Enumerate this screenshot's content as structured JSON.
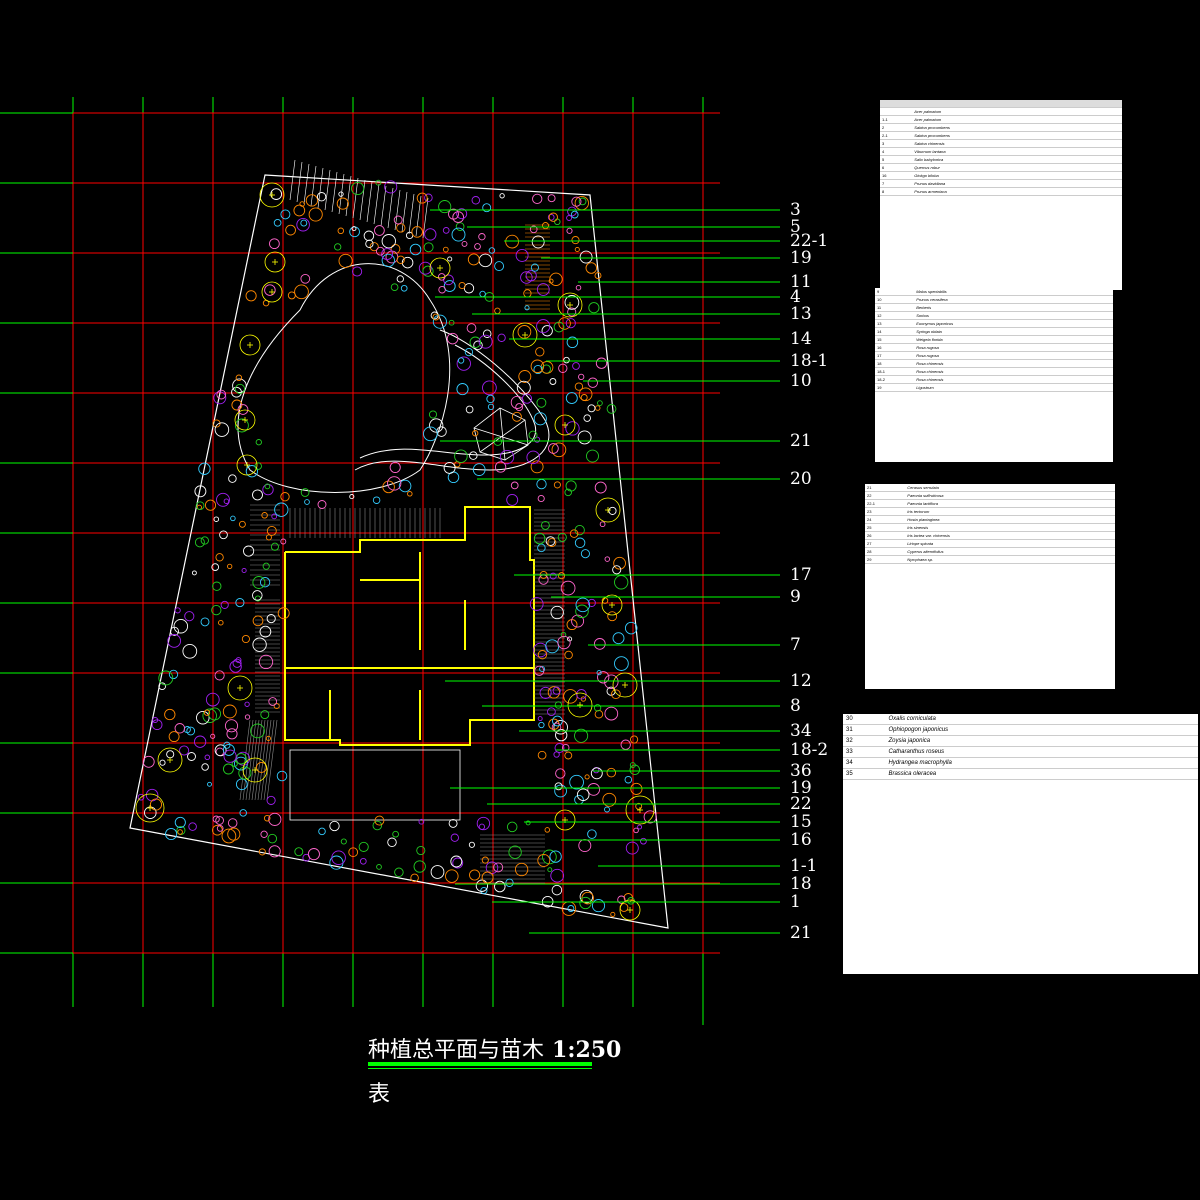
{
  "title": {
    "main": "种植总平面与苗木",
    "scale": "1:250",
    "sub": "表"
  },
  "callouts": [
    "3",
    "5",
    "22-1",
    "19",
    "11",
    "4",
    "13",
    "14",
    "18-1",
    "10",
    "21",
    "20",
    "17",
    "9",
    "7",
    "12",
    "8",
    "34",
    "18-2",
    "36",
    "19",
    "22",
    "15",
    "16",
    "1-1",
    "18",
    "1",
    "21"
  ],
  "colors": {
    "background": "#000000",
    "grid": "#ff0000",
    "grid_ticks": "#00ff00",
    "building": "#ffff00",
    "leader": "#00ff00",
    "boundary": "#ffffff",
    "shrub_orange": "#ff8800",
    "shrub_purple": "#a020f0",
    "shrub_pink": "#ff66cc",
    "tree_green": "#22cc22",
    "tree_cyan": "#33ccff"
  },
  "tables": {
    "sheet1": {
      "rows": [
        [
          "",
          "Acer palmatum",
          "",
          "",
          "",
          "",
          "",
          ""
        ],
        [
          "1-1",
          "Acer palmatum",
          "",
          "",
          "",
          "",
          "",
          ""
        ],
        [
          "2",
          "Sabina procumbens",
          "",
          "",
          "",
          "",
          "",
          ""
        ],
        [
          "2-1",
          "Sabina procumbens",
          "",
          "",
          "",
          "",
          "",
          ""
        ],
        [
          "3",
          "Sabina chinensis",
          "",
          "",
          "",
          "",
          "",
          ""
        ],
        [
          "4",
          "Viburnum lantana",
          "",
          "",
          "",
          "",
          "",
          ""
        ],
        [
          "5",
          "Salix babylonica",
          "",
          "",
          "",
          "",
          "",
          ""
        ],
        [
          "6",
          "Quercus robur",
          "",
          "",
          "",
          "",
          "",
          ""
        ],
        [
          "16",
          "Ginkgo biloba",
          "",
          "",
          "",
          "",
          "",
          ""
        ],
        [
          "7",
          "Prunus davidiana",
          "",
          "",
          "",
          "",
          "",
          ""
        ],
        [
          "8",
          "Prunus armeniaca",
          "",
          "",
          "",
          "",
          "",
          ""
        ]
      ]
    },
    "sheet2": {
      "rows": [
        [
          "9",
          "Malus spectabilis",
          "",
          "",
          "",
          "",
          ""
        ],
        [
          "10",
          "Prunus cerasifera",
          "",
          "",
          "",
          "",
          ""
        ],
        [
          "11",
          "Berberis",
          "",
          "",
          "",
          "",
          ""
        ],
        [
          "12",
          "Sorbus",
          "",
          "",
          "",
          "",
          ""
        ],
        [
          "13",
          "Euonymus japonicus",
          "",
          "",
          "",
          "",
          ""
        ],
        [
          "14",
          "Syringa oblata",
          "",
          "",
          "",
          "",
          ""
        ],
        [
          "15",
          "Weigela florida",
          "",
          "",
          "",
          "",
          ""
        ],
        [
          "16",
          "Rosa rugosa",
          "",
          "",
          "",
          "",
          ""
        ],
        [
          "17",
          "Rosa rugosa",
          "",
          "",
          "",
          "",
          ""
        ],
        [
          "18",
          "Rosa chinensis",
          "",
          "",
          "",
          "",
          ""
        ],
        [
          "18-1",
          "Rosa chinensis",
          "",
          "",
          "",
          "",
          ""
        ],
        [
          "18-2",
          "Rosa chinensis",
          "",
          "",
          "",
          "",
          ""
        ],
        [
          "19",
          "Ligustrum",
          "",
          "",
          "",
          "",
          ""
        ]
      ]
    },
    "sheet3": {
      "rows": [
        [
          "21",
          "Cerasus serrulata",
          "",
          "",
          "",
          ""
        ],
        [
          "22",
          "Paeonia suffruticosa",
          "",
          "",
          "",
          ""
        ],
        [
          "22-1",
          "Paeonia lactiflora",
          "",
          "",
          "",
          ""
        ],
        [
          "23",
          "Iris tectorum",
          "",
          "",
          "",
          ""
        ],
        [
          "24",
          "Hosta plantaginea",
          "",
          "",
          "",
          ""
        ],
        [
          "25",
          "Iris sinensis",
          "",
          "",
          "",
          ""
        ],
        [
          "26",
          "Iris lactea var. chinensis",
          "",
          "",
          "",
          ""
        ],
        [
          "27",
          "Liriope spicata",
          "",
          "",
          "",
          ""
        ],
        [
          "28",
          "Cyperus alternifolius",
          "",
          "",
          "",
          ""
        ],
        [
          "29",
          "Nymphaea sp.",
          "",
          "",
          "",
          ""
        ]
      ]
    },
    "sheet4": {
      "rows": [
        [
          "30",
          "Oxalis corniculata",
          "",
          "",
          "",
          ""
        ],
        [
          "31",
          "Ophiopogon japonicus",
          "",
          "",
          "",
          ""
        ],
        [
          "32",
          "Zoysia japonica",
          "",
          "",
          "",
          ""
        ],
        [
          "33",
          "Catharanthus roseus",
          "",
          "",
          "",
          ""
        ],
        [
          "34",
          "Hydrangea macrophylla",
          "",
          "",
          "",
          ""
        ],
        [
          "35",
          "Brassica oleracea",
          "",
          "",
          "",
          ""
        ]
      ]
    }
  }
}
